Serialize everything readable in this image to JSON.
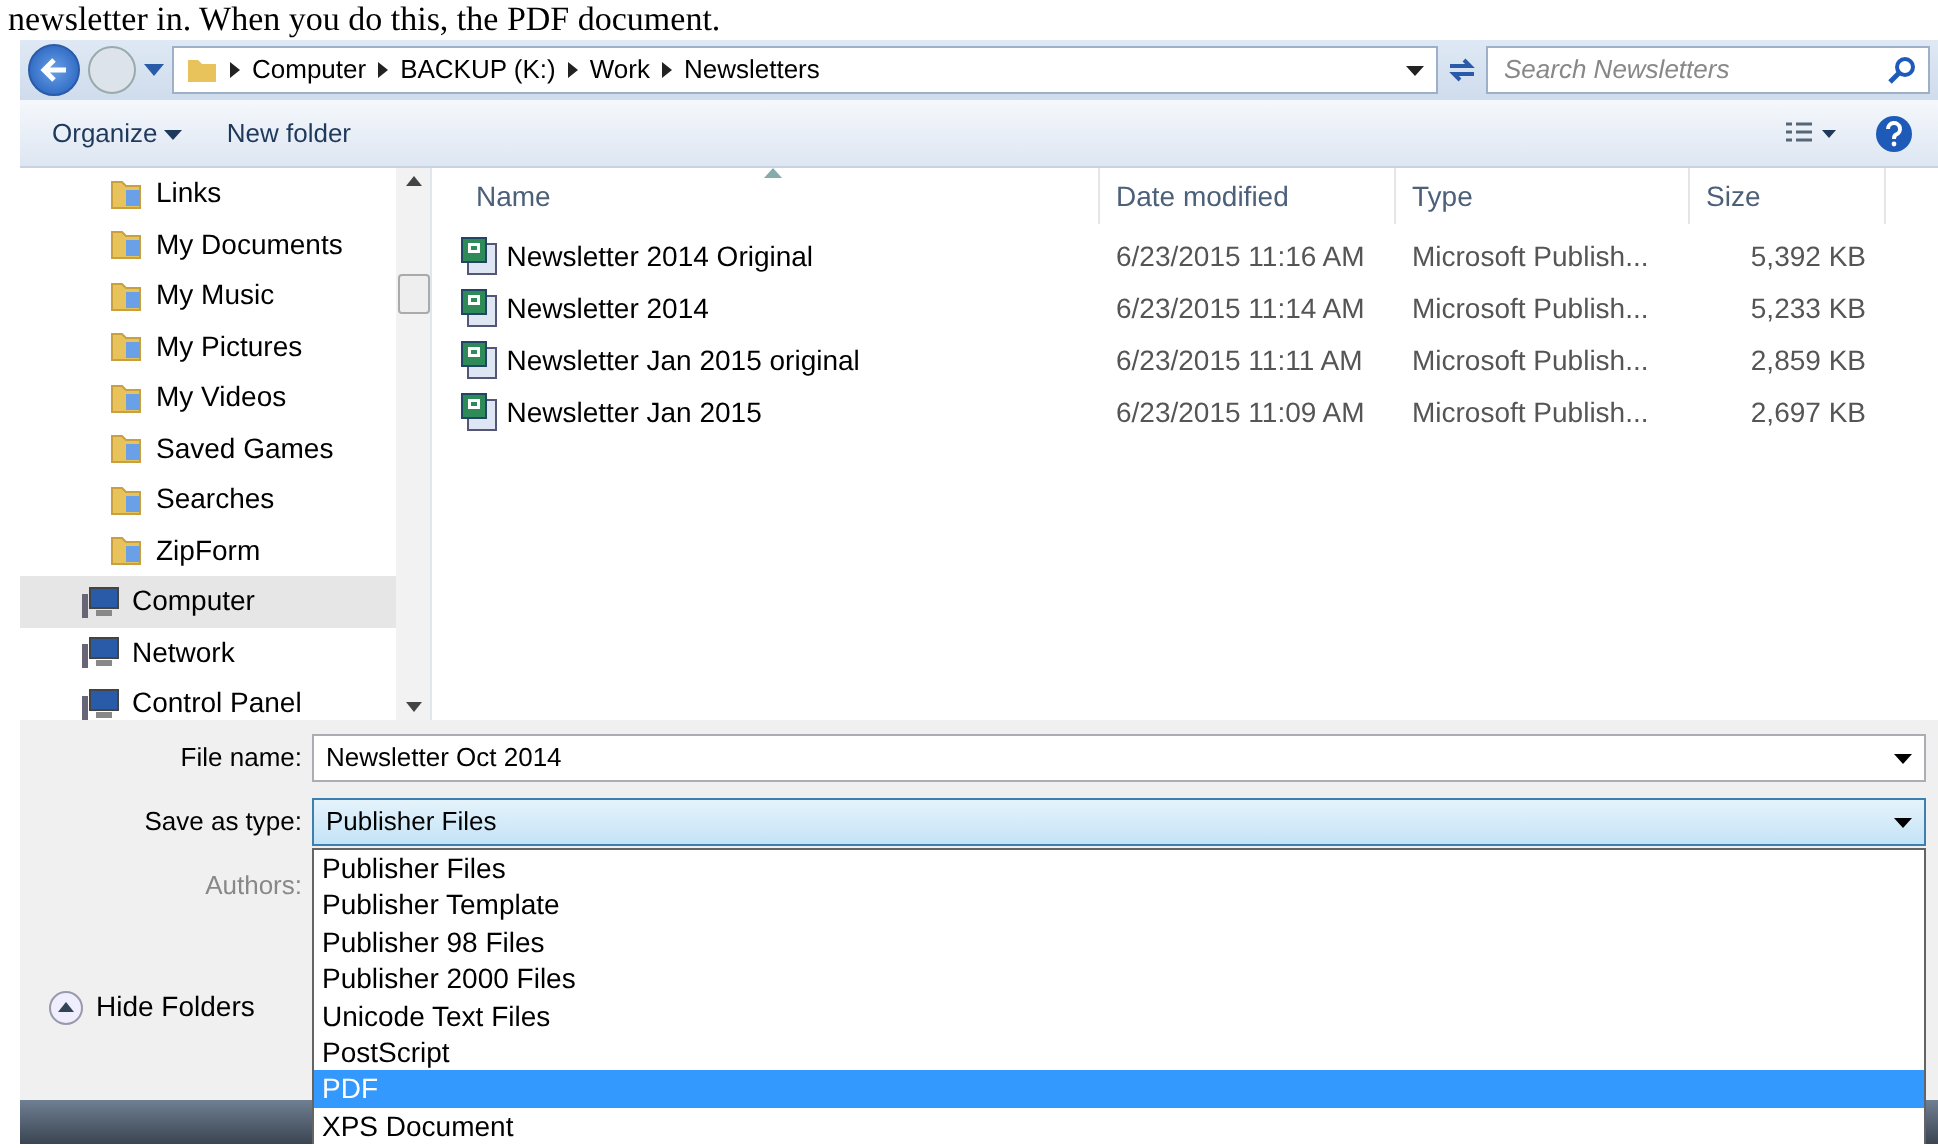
{
  "document_text": "newsletter in.  When you do this, the PDF document.",
  "address_bar": {
    "crumbs": [
      "Computer",
      "BACKUP (K:)",
      "Work",
      "Newsletters"
    ]
  },
  "search": {
    "placeholder": "Search Newsletters"
  },
  "toolbar": {
    "buttons": [
      "Organize",
      "New folder"
    ]
  },
  "sidebar": {
    "items": [
      {
        "label": "Links",
        "kind": "subfolder",
        "selected": false
      },
      {
        "label": "My Documents",
        "kind": "subfolder",
        "selected": false
      },
      {
        "label": "My Music",
        "kind": "subfolder",
        "selected": false
      },
      {
        "label": "My Pictures",
        "kind": "subfolder",
        "selected": false
      },
      {
        "label": "My Videos",
        "kind": "subfolder",
        "selected": false
      },
      {
        "label": "Saved Games",
        "kind": "subfolder",
        "selected": false
      },
      {
        "label": "Searches",
        "kind": "subfolder",
        "selected": false
      },
      {
        "label": "ZipForm",
        "kind": "subfolder",
        "selected": false
      },
      {
        "label": "Computer",
        "kind": "location",
        "selected": true
      },
      {
        "label": "Network",
        "kind": "location",
        "selected": false
      },
      {
        "label": "Control Panel",
        "kind": "location",
        "selected": false
      }
    ]
  },
  "table": {
    "columns": [
      "Name",
      "Date modified",
      "Type",
      "Size"
    ],
    "rows": [
      [
        "Newsletter  2014 Original",
        "6/23/2015 11:16 AM",
        "Microsoft Publish...",
        "5,392 KB"
      ],
      [
        "Newsletter  2014",
        "6/23/2015 11:14 AM",
        "Microsoft Publish...",
        "5,233 KB"
      ],
      [
        "Newsletter  Jan 2015 original",
        "6/23/2015 11:11 AM",
        "Microsoft Publish...",
        "2,859 KB"
      ],
      [
        "Newsletter  Jan 2015",
        "6/23/2015 11:09 AM",
        "Microsoft Publish...",
        "2,697 KB"
      ]
    ]
  },
  "form": {
    "file_name_label": "File name:",
    "file_name": "Newsletter  Oct 2014",
    "type_label": "Save as type:",
    "type_value": "Publisher Files",
    "authors_label": "Authors:"
  },
  "type_options": [
    {
      "label": "Publisher Files",
      "selected": false
    },
    {
      "label": "Publisher Template",
      "selected": false
    },
    {
      "label": "Publisher 98 Files",
      "selected": false
    },
    {
      "label": "Publisher 2000 Files",
      "selected": false
    },
    {
      "label": "Unicode Text Files",
      "selected": false
    },
    {
      "label": "PostScript",
      "selected": false
    },
    {
      "label": "PDF",
      "selected": true
    },
    {
      "label": "XPS Document",
      "selected": false
    }
  ],
  "hide_folders": "Hide Folders"
}
